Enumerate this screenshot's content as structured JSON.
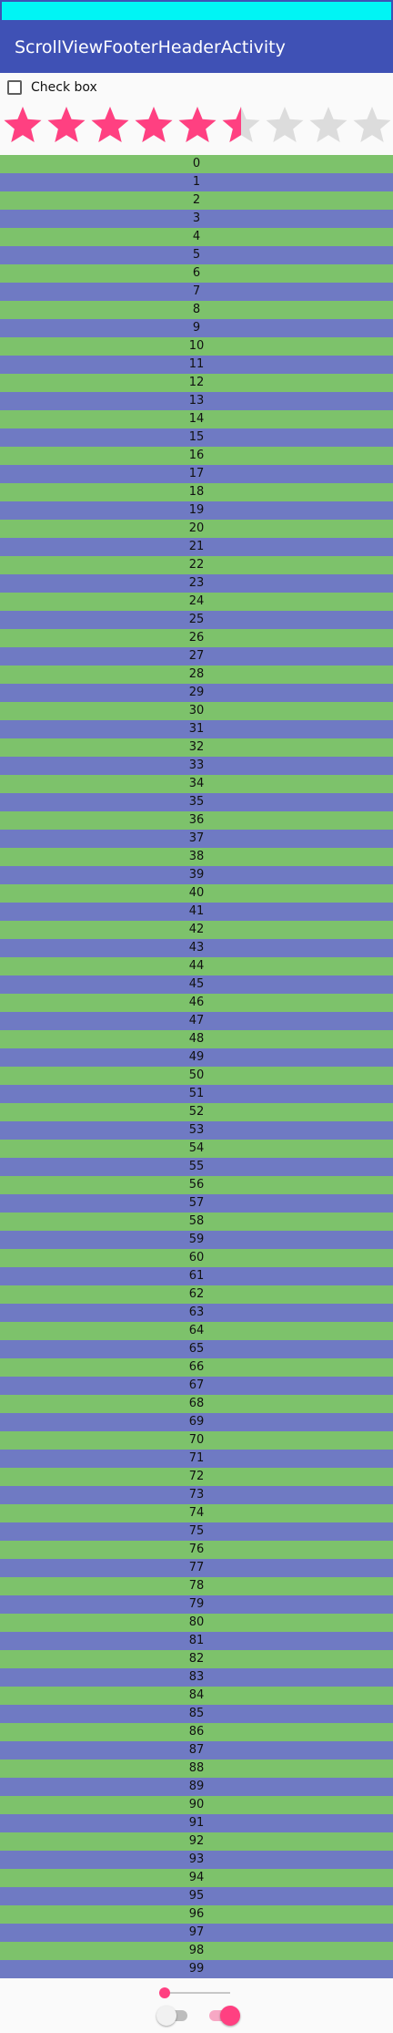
{
  "app_bar": {
    "title": "ScrollViewFooterHeaderActivity"
  },
  "header": {
    "checkbox": {
      "label": "Check box",
      "checked": false
    },
    "rating": {
      "value": 5.5,
      "max": 9
    }
  },
  "list": {
    "items": [
      "0",
      "1",
      "2",
      "3",
      "4",
      "5",
      "6",
      "7",
      "8",
      "9",
      "10",
      "11",
      "12",
      "13",
      "14",
      "15",
      "16",
      "17",
      "18",
      "19",
      "20",
      "21",
      "22",
      "23",
      "24",
      "25",
      "26",
      "27",
      "28",
      "29",
      "30",
      "31",
      "32",
      "33",
      "34",
      "35",
      "36",
      "37",
      "38",
      "39",
      "40",
      "41",
      "42",
      "43",
      "44",
      "45",
      "46",
      "47",
      "48",
      "49",
      "50",
      "51",
      "52",
      "53",
      "54",
      "55",
      "56",
      "57",
      "58",
      "59",
      "60",
      "61",
      "62",
      "63",
      "64",
      "65",
      "66",
      "67",
      "68",
      "69",
      "70",
      "71",
      "72",
      "73",
      "74",
      "75",
      "76",
      "77",
      "78",
      "79",
      "80",
      "81",
      "82",
      "83",
      "84",
      "85",
      "86",
      "87",
      "88",
      "89",
      "90",
      "91",
      "92",
      "93",
      "94",
      "95",
      "96",
      "97",
      "98",
      "99"
    ]
  },
  "footer": {
    "seekbar": {
      "progress": 0
    },
    "switch_1": {
      "checked": false
    },
    "switch_2": {
      "checked": true
    }
  },
  "colors": {
    "status_bar": "#00f5f5",
    "app_bar": "#3f51b5",
    "accent": "#ff4081",
    "row_even": "#7dc26b",
    "row_odd": "#6f7ac3",
    "star_empty": "#dcdcdc"
  }
}
